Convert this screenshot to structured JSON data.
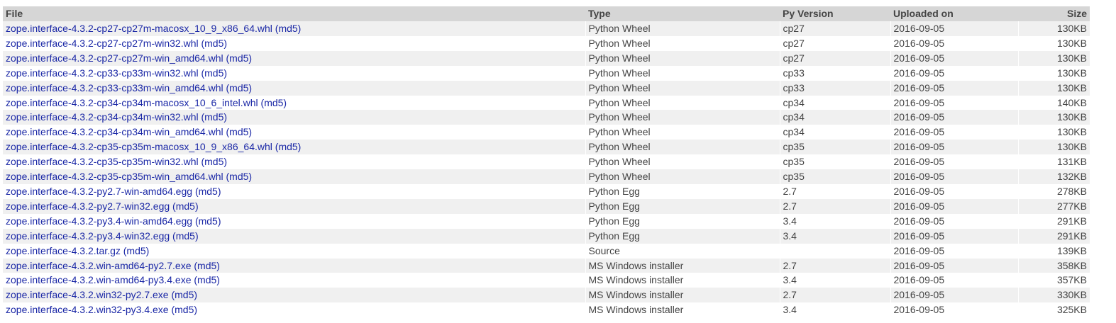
{
  "table": {
    "headers": {
      "file": "File",
      "type": "Type",
      "py_version": "Py Version",
      "uploaded_on": "Uploaded on",
      "size": "Size"
    },
    "md5_label": "(md5)",
    "rows": [
      {
        "file": "zope.interface-4.3.2-cp27-cp27m-macosx_10_9_x86_64.whl",
        "type": "Python Wheel",
        "py": "cp27",
        "uploaded": "2016-09-05",
        "size": "130KB"
      },
      {
        "file": "zope.interface-4.3.2-cp27-cp27m-win32.whl",
        "type": "Python Wheel",
        "py": "cp27",
        "uploaded": "2016-09-05",
        "size": "130KB"
      },
      {
        "file": "zope.interface-4.3.2-cp27-cp27m-win_amd64.whl",
        "type": "Python Wheel",
        "py": "cp27",
        "uploaded": "2016-09-05",
        "size": "130KB"
      },
      {
        "file": "zope.interface-4.3.2-cp33-cp33m-win32.whl",
        "type": "Python Wheel",
        "py": "cp33",
        "uploaded": "2016-09-05",
        "size": "130KB"
      },
      {
        "file": "zope.interface-4.3.2-cp33-cp33m-win_amd64.whl",
        "type": "Python Wheel",
        "py": "cp33",
        "uploaded": "2016-09-05",
        "size": "130KB"
      },
      {
        "file": "zope.interface-4.3.2-cp34-cp34m-macosx_10_6_intel.whl",
        "type": "Python Wheel",
        "py": "cp34",
        "uploaded": "2016-09-05",
        "size": "140KB"
      },
      {
        "file": "zope.interface-4.3.2-cp34-cp34m-win32.whl",
        "type": "Python Wheel",
        "py": "cp34",
        "uploaded": "2016-09-05",
        "size": "130KB"
      },
      {
        "file": "zope.interface-4.3.2-cp34-cp34m-win_amd64.whl",
        "type": "Python Wheel",
        "py": "cp34",
        "uploaded": "2016-09-05",
        "size": "130KB"
      },
      {
        "file": "zope.interface-4.3.2-cp35-cp35m-macosx_10_9_x86_64.whl",
        "type": "Python Wheel",
        "py": "cp35",
        "uploaded": "2016-09-05",
        "size": "130KB"
      },
      {
        "file": "zope.interface-4.3.2-cp35-cp35m-win32.whl",
        "type": "Python Wheel",
        "py": "cp35",
        "uploaded": "2016-09-05",
        "size": "131KB"
      },
      {
        "file": "zope.interface-4.3.2-cp35-cp35m-win_amd64.whl",
        "type": "Python Wheel",
        "py": "cp35",
        "uploaded": "2016-09-05",
        "size": "132KB"
      },
      {
        "file": "zope.interface-4.3.2-py2.7-win-amd64.egg",
        "type": "Python Egg",
        "py": "2.7",
        "uploaded": "2016-09-05",
        "size": "278KB"
      },
      {
        "file": "zope.interface-4.3.2-py2.7-win32.egg",
        "type": "Python Egg",
        "py": "2.7",
        "uploaded": "2016-09-05",
        "size": "277KB"
      },
      {
        "file": "zope.interface-4.3.2-py3.4-win-amd64.egg",
        "type": "Python Egg",
        "py": "3.4",
        "uploaded": "2016-09-05",
        "size": "291KB"
      },
      {
        "file": "zope.interface-4.3.2-py3.4-win32.egg",
        "type": "Python Egg",
        "py": "3.4",
        "uploaded": "2016-09-05",
        "size": "291KB"
      },
      {
        "file": "zope.interface-4.3.2.tar.gz",
        "type": "Source",
        "py": "",
        "uploaded": "2016-09-05",
        "size": "139KB"
      },
      {
        "file": "zope.interface-4.3.2.win-amd64-py2.7.exe",
        "type": "MS Windows installer",
        "py": "2.7",
        "uploaded": "2016-09-05",
        "size": "358KB"
      },
      {
        "file": "zope.interface-4.3.2.win-amd64-py3.4.exe",
        "type": "MS Windows installer",
        "py": "3.4",
        "uploaded": "2016-09-05",
        "size": "357KB"
      },
      {
        "file": "zope.interface-4.3.2.win32-py2.7.exe",
        "type": "MS Windows installer",
        "py": "2.7",
        "uploaded": "2016-09-05",
        "size": "330KB"
      },
      {
        "file": "zope.interface-4.3.2.win32-py3.4.exe",
        "type": "MS Windows installer",
        "py": "3.4",
        "uploaded": "2016-09-05",
        "size": "325KB"
      }
    ]
  },
  "colors": {
    "link": "#1a27a6",
    "text": "#444444",
    "header_bg": "#d6d6d6",
    "row_odd_bg": "#f0f0f0",
    "row_even_bg": "#ffffff"
  }
}
